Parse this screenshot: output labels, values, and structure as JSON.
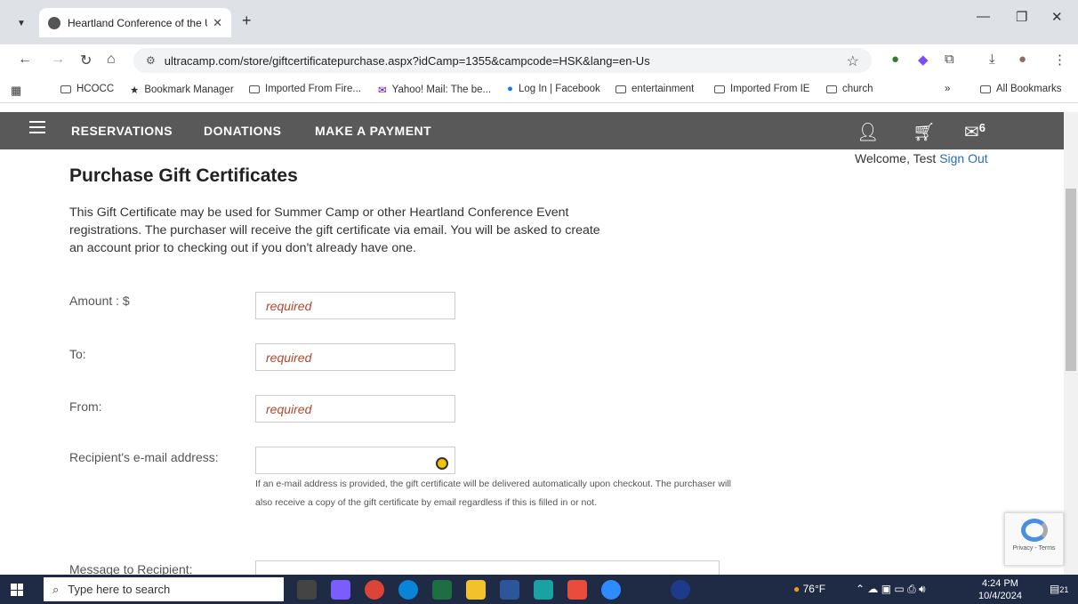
{
  "browser": {
    "tab_title": "Heartland Conference of the Un",
    "url": "ultracamp.com/store/giftcertificatepurchase.aspx?idCamp=1355&campcode=HSK&lang=en-Us",
    "bookmarks": [
      "HCOCC",
      "Bookmark Manager",
      "Imported From Fire...",
      "Yahoo! Mail: The be...",
      "Log In | Facebook",
      "entertainment",
      "Imported From IE",
      "church",
      "All Bookmarks"
    ]
  },
  "site_nav": {
    "links": [
      "RESERVATIONS",
      "DONATIONS",
      "MAKE A PAYMENT"
    ],
    "message_count": "6"
  },
  "welcome": {
    "text": "Welcome, Test",
    "sign_out": "Sign Out"
  },
  "page": {
    "title": "Purchase Gift Certificates",
    "intro": "This Gift Certificate may be used for Summer Camp or other Heartland Conference Event registrations. The purchaser will receive the gift certificate via email. You will be asked to create an account prior to checking out if you don't already have one."
  },
  "form": {
    "amount_label": "Amount : $",
    "amount_placeholder": "required",
    "to_label": "To:",
    "to_placeholder": "required",
    "from_label": "From:",
    "from_placeholder": "required",
    "email_label": "Recipient's e-mail address:",
    "email_help": "If an e-mail address is provided, the gift certificate will be delivered automatically upon checkout. The purchaser will also receive a copy of the gift certificate by email regardless if this is filled in or not.",
    "message_label": "Message to Recipient:"
  },
  "recaptcha": {
    "text": "Privacy - Terms"
  },
  "taskbar": {
    "search_placeholder": "Type here to search",
    "weather": "76°F",
    "time": "4:24 PM",
    "date": "10/4/2024",
    "notification_count": "21"
  }
}
